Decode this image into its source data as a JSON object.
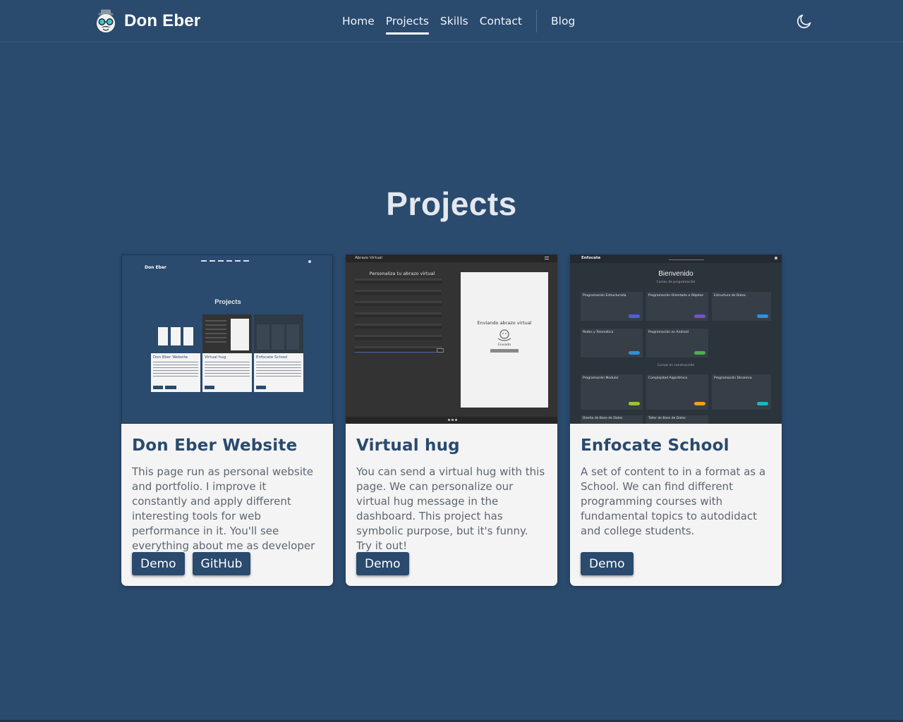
{
  "header": {
    "brand": "Don Eber",
    "nav": [
      {
        "label": "Home",
        "active": false
      },
      {
        "label": "Projects",
        "active": true
      },
      {
        "label": "Skills",
        "active": false
      },
      {
        "label": "Contact",
        "active": false
      }
    ],
    "blog_label": "Blog",
    "theme_toggle_icon": "moon-icon"
  },
  "main": {
    "title": "Projects",
    "projects": [
      {
        "title": "Don Eber Website",
        "description": "This page run as personal website and portfolio. I improve it constantly and apply different interesting tools for web performance in it. You'll see everything about me as developer",
        "buttons": [
          "Demo",
          "GitHub"
        ],
        "thumb": {
          "header_brand": "Don Eber",
          "title": "Projects",
          "cards": [
            "Don Eber Website",
            "Virtual hug",
            "Enfocate School"
          ]
        }
      },
      {
        "title": "Virtual hug",
        "description": "You can send a virtual hug with this page. We can personalize our virtual hug message in the dashboard. This project has symbolic purpose, but it's funny. Try it out!",
        "buttons": [
          "Demo"
        ],
        "thumb": {
          "header": "Abrazo Virtual",
          "form_title": "Personaliza tu abrazo virtual",
          "preview_text": "Enviando abrazo virtual",
          "preview_sub": "Enviado"
        }
      },
      {
        "title": "Enfocate School",
        "description": "A set of content to in a format as a School. We can find different programming courses with fundamental topics to autodidact and college students.",
        "buttons": [
          "Demo"
        ],
        "thumb": {
          "brand": "Enfocate",
          "heading": "Bienvenido",
          "subheading": "Cursos de programación",
          "courses": [
            "Programación Estructurada",
            "Programación Orientada a Objetos",
            "Estructura de Datos",
            "Redes y Telemática",
            "Programación en Android"
          ],
          "section_label": "Cursos en construcción",
          "upcoming": [
            "Programación Modular",
            "Complejidad Algorítmica",
            "Programación Dinamica"
          ],
          "footer_items": [
            "Diseño de Base de Datos",
            "Taller de Base de Datos"
          ]
        }
      }
    ]
  },
  "colors": {
    "background": "#2a4a6e",
    "card": "#f4f4f5",
    "button": "#2a4a6e",
    "card_title": "#2a4a6e"
  }
}
